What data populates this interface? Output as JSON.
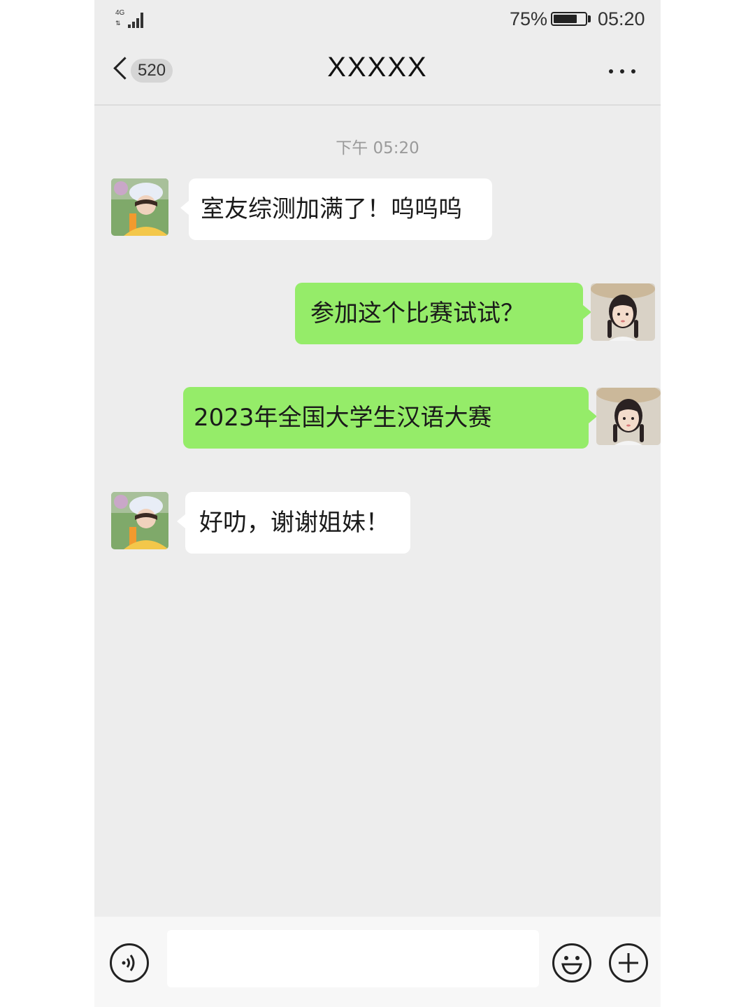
{
  "status_bar": {
    "network": "4G",
    "battery_percent": "75%",
    "battery_level": 0.75,
    "time": "05:20"
  },
  "nav": {
    "back_count": "520",
    "title": "XXXXX",
    "more_icon": "more-dots-icon"
  },
  "chat": {
    "timestamp": "下午 05:20",
    "messages": [
      {
        "direction": "incoming",
        "text": "室友综测加满了！呜呜呜"
      },
      {
        "direction": "outgoing",
        "text": "参加这个比赛试试？"
      },
      {
        "direction": "outgoing",
        "text": "2023年全国大学生汉语大赛"
      },
      {
        "direction": "incoming",
        "text": "好叻，谢谢姐妹！"
      }
    ]
  },
  "input_bar": {
    "voice_icon": "voice-icon",
    "input_value": "",
    "emoji_icon": "emoji-icon",
    "plus_icon": "plus-icon"
  },
  "colors": {
    "background": "#ededed",
    "outgoing_bubble": "#95ec69",
    "incoming_bubble": "#ffffff",
    "timestamp": "#9a9a9a"
  }
}
